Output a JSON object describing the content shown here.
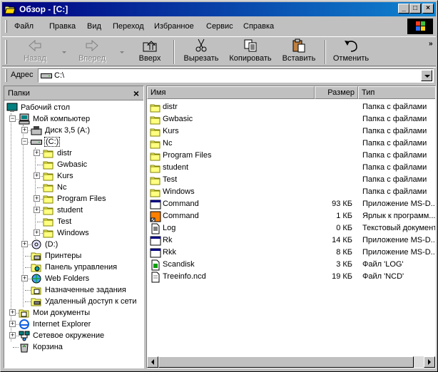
{
  "window": {
    "title": "Обзор - [C:]",
    "buttons": {
      "minimize": "_",
      "maximize": "□",
      "close": "×"
    }
  },
  "menu": [
    {
      "label": "Файл"
    },
    {
      "label": "Правка"
    },
    {
      "label": "Вид"
    },
    {
      "label": "Переход"
    },
    {
      "label": "Избранное"
    },
    {
      "label": "Сервис"
    },
    {
      "label": "Справка"
    }
  ],
  "toolbar": {
    "back": "Назад",
    "forward": "Вперед",
    "up": "Вверх",
    "cut": "Вырезать",
    "copy": "Копировать",
    "paste": "Вставить",
    "undo": "Отменить",
    "more": "»"
  },
  "address": {
    "label": "Адрес",
    "value": "C:\\"
  },
  "folders_pane": {
    "title": "Папки",
    "close": "×",
    "tree": [
      {
        "label": "Рабочий стол",
        "icon": "desktop-icon"
      },
      {
        "label": "Мой компьютер",
        "icon": "computer-icon",
        "expander": "−"
      },
      {
        "label": "Диск 3,5 (A:)",
        "icon": "floppy-icon",
        "expander": "+"
      },
      {
        "label": "(C:)",
        "icon": "drive-icon",
        "expander": "−"
      },
      {
        "label": "distr",
        "icon": "folder-icon",
        "expander": "+"
      },
      {
        "label": "Gwbasic",
        "icon": "folder-icon"
      },
      {
        "label": "Kurs",
        "icon": "folder-icon",
        "expander": "+"
      },
      {
        "label": "Nc",
        "icon": "folder-icon"
      },
      {
        "label": "Program Files",
        "icon": "folder-icon",
        "expander": "+"
      },
      {
        "label": "student",
        "icon": "folder-icon",
        "expander": "+"
      },
      {
        "label": "Test",
        "icon": "folder-icon"
      },
      {
        "label": "Windows",
        "icon": "folder-icon",
        "expander": "+"
      },
      {
        "label": "(D:)",
        "icon": "cdrom-icon",
        "expander": "+"
      },
      {
        "label": "Принтеры",
        "icon": "printers-icon"
      },
      {
        "label": "Панель управления",
        "icon": "control-panel-icon"
      },
      {
        "label": "Web Folders",
        "icon": "web-folders-icon",
        "expander": "+"
      },
      {
        "label": "Назначенные задания",
        "icon": "scheduled-tasks-icon"
      },
      {
        "label": "Удаленный доступ к сети",
        "icon": "dialup-icon"
      },
      {
        "label": "Мои документы",
        "icon": "my-documents-icon",
        "expander": "+"
      },
      {
        "label": "Internet Explorer",
        "icon": "ie-icon",
        "expander": "+"
      },
      {
        "label": "Сетевое окружение",
        "icon": "network-icon",
        "expander": "+"
      },
      {
        "label": "Корзина",
        "icon": "recycle-bin-icon"
      }
    ]
  },
  "file_list": {
    "columns": {
      "name": "Имя",
      "size": "Размер",
      "type": "Тип"
    },
    "rows": [
      {
        "name": "distr",
        "size": "",
        "type": "Папка с файлами",
        "icon": "folder-icon"
      },
      {
        "name": "Gwbasic",
        "size": "",
        "type": "Папка с файлами",
        "icon": "folder-icon"
      },
      {
        "name": "Kurs",
        "size": "",
        "type": "Папка с файлами",
        "icon": "folder-icon"
      },
      {
        "name": "Nc",
        "size": "",
        "type": "Папка с файлами",
        "icon": "folder-icon"
      },
      {
        "name": "Program Files",
        "size": "",
        "type": "Папка с файлами",
        "icon": "folder-icon"
      },
      {
        "name": "student",
        "size": "",
        "type": "Папка с файлами",
        "icon": "folder-icon"
      },
      {
        "name": "Test",
        "size": "",
        "type": "Папка с файлами",
        "icon": "folder-icon"
      },
      {
        "name": "Windows",
        "size": "",
        "type": "Папка с файлами",
        "icon": "folder-icon"
      },
      {
        "name": "Command",
        "size": "93 КБ",
        "type": "Приложение MS-D...",
        "icon": "msdos-app-icon"
      },
      {
        "name": "Command",
        "size": "1 КБ",
        "type": "Ярлык к программ...",
        "icon": "shortcut-icon"
      },
      {
        "name": "Log",
        "size": "0 КБ",
        "type": "Текстовый документ",
        "icon": "text-doc-icon"
      },
      {
        "name": "Rk",
        "size": "14 КБ",
        "type": "Приложение MS-D...",
        "icon": "msdos-app-icon"
      },
      {
        "name": "Rkk",
        "size": "8 КБ",
        "type": "Приложение MS-D...",
        "icon": "msdos-app-icon"
      },
      {
        "name": "Scandisk",
        "size": "3 КБ",
        "type": "Файл 'LOG'",
        "icon": "log-file-icon"
      },
      {
        "name": "Treeinfo.ncd",
        "size": "19 КБ",
        "type": "Файл 'NCD'",
        "icon": "ncd-file-icon"
      }
    ]
  }
}
